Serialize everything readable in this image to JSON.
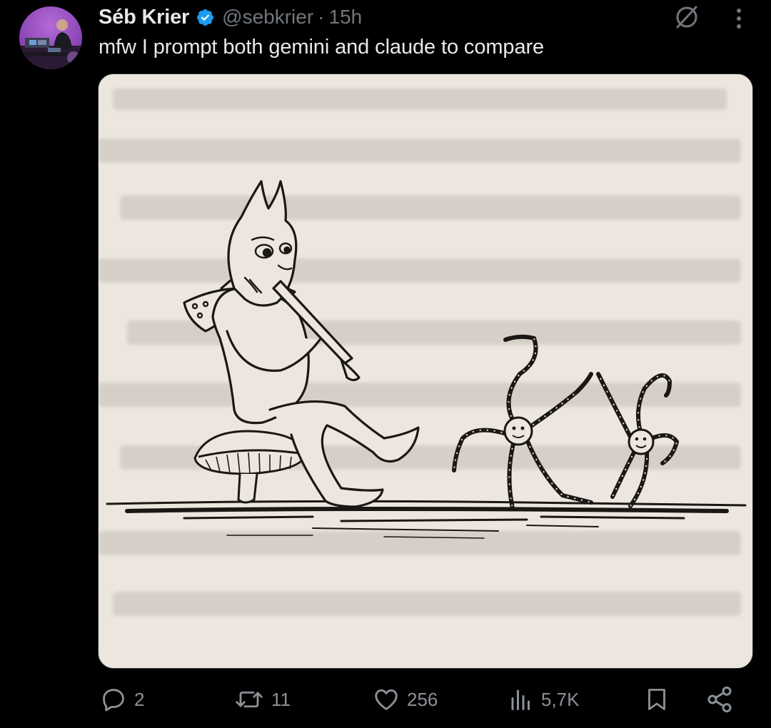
{
  "tweet": {
    "author_name": "Séb Krier",
    "handle": "@sebkrier",
    "separator": "·",
    "time": "15h",
    "text": "mfw I prompt both gemini and claude to compare",
    "media_alt_icon": "image",
    "grok_icon": "grok-icon",
    "more_icon": "more-icon"
  },
  "actions": {
    "replies": "2",
    "reposts": "11",
    "likes": "256",
    "views": "5,7K"
  },
  "colors": {
    "background": "#000000",
    "text_primary": "#e7e9ea",
    "text_secondary": "#71767b",
    "verified": "#1d9bf0",
    "media_bg": "#ece6df"
  }
}
